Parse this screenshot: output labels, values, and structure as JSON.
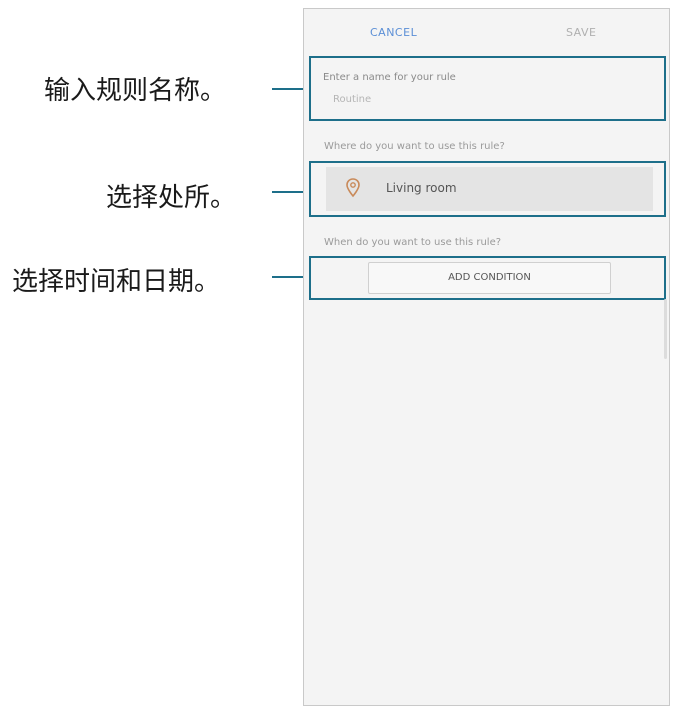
{
  "callouts": [
    {
      "label": "输入规则名称。"
    },
    {
      "label": "选择处所。"
    },
    {
      "label": "选择时间和日期。"
    }
  ],
  "screen": {
    "cancel_label": "CANCEL",
    "save_label": "SAVE",
    "name_prompt": "Enter a name for your rule",
    "name_placeholder": "Routine",
    "where_prompt": "Where do you want to use this rule?",
    "place_value": "Living room",
    "when_prompt": "When do you want to use this rule?",
    "add_condition_label": "ADD CONDITION"
  },
  "colors": {
    "accent": "#1d6f8a",
    "cancel": "#5b8fd6",
    "pin": "#c98a5a"
  }
}
